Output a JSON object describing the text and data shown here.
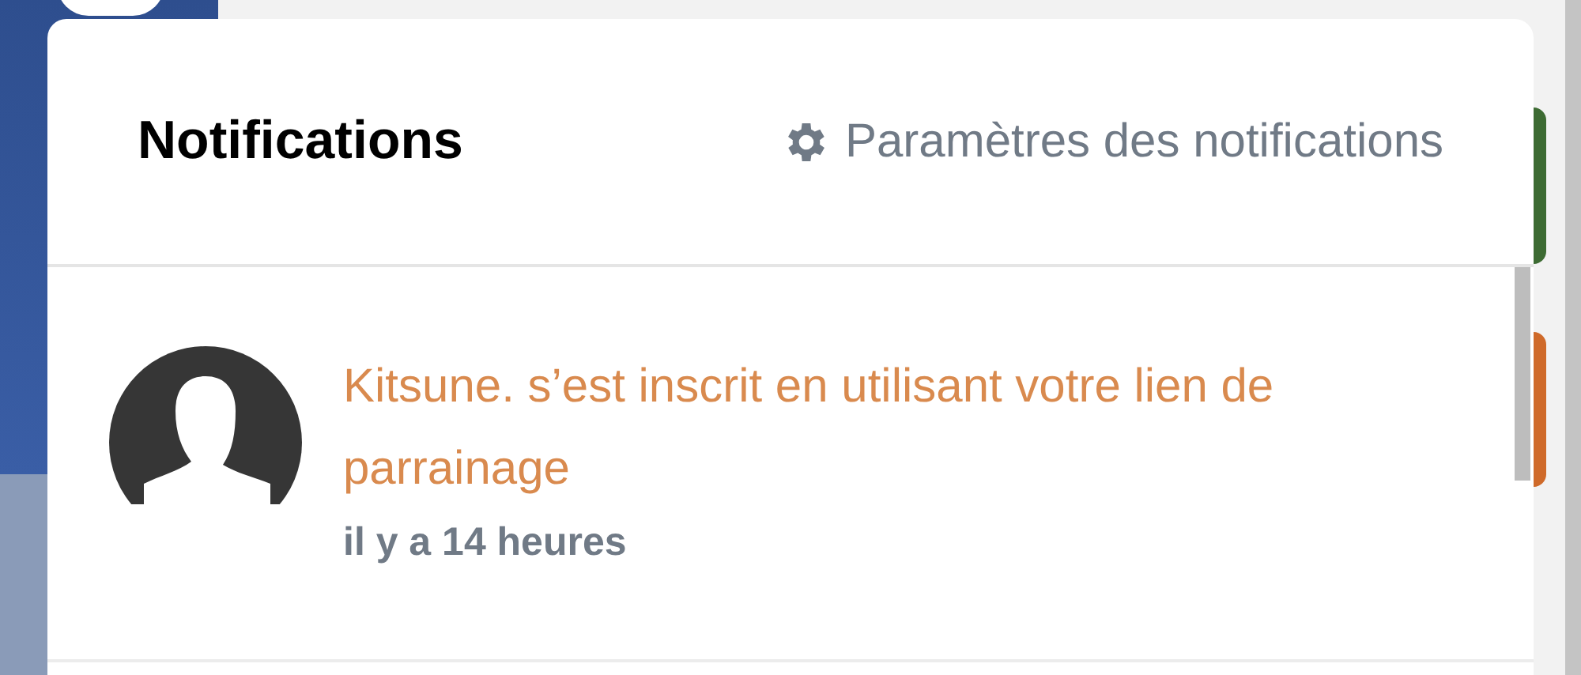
{
  "panel": {
    "title": "Notifications",
    "settings_link": "Paramètres des notifications"
  },
  "notifications": [
    {
      "message": "Kitsune. s’est inscrit en utilisant votre lien de parrainage",
      "time": "il y a 14 heures"
    }
  ]
}
